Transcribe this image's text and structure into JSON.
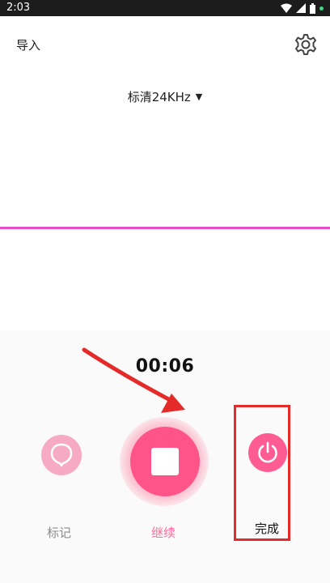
{
  "status_bar": {
    "time": "2:03"
  },
  "header": {
    "import_label": "导入",
    "settings_icon": "gear-icon"
  },
  "quality": {
    "label": "标清24KHz",
    "caret": "▼"
  },
  "recorder": {
    "timer": "00:06",
    "mark_label": "标记",
    "continue_label": "继续",
    "done_label": "完成"
  },
  "colors": {
    "accent": "#ff5489",
    "waveform": "#e54fc8",
    "annotation": "#e52a2a",
    "mark_button": "#f6aac3"
  }
}
